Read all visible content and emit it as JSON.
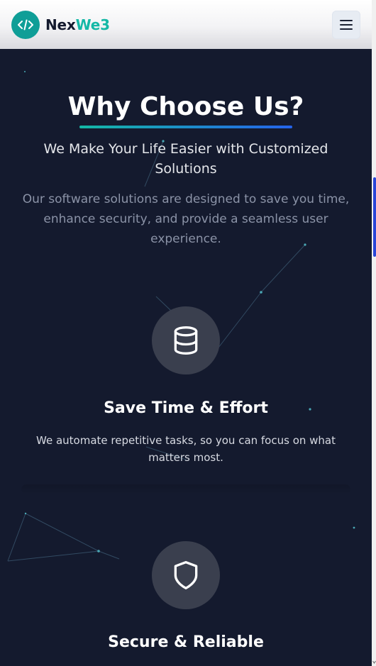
{
  "header": {
    "brand_part1": "Nex",
    "brand_part2": "We3",
    "logo_icon": "code-icon",
    "menu_icon": "hamburger-menu-icon",
    "brand_color": "#14b8a6",
    "background": "#ffffff"
  },
  "section": {
    "title": "Why Choose Us?",
    "subtitle": "We Make Your Life Easier with Customized Solutions",
    "description": "Our software solutions are designed to save you time, enhance security, and provide a seamless user experience.",
    "underline_colors": [
      "#14b8a6",
      "#2563eb"
    ],
    "background": "#141a2e"
  },
  "features": [
    {
      "icon": "database-icon",
      "title": "Save Time & Effort",
      "text": "We automate repetitive tasks, so you can focus on what matters most."
    },
    {
      "icon": "shield-icon",
      "title": "Secure & Reliable",
      "text": ""
    }
  ]
}
